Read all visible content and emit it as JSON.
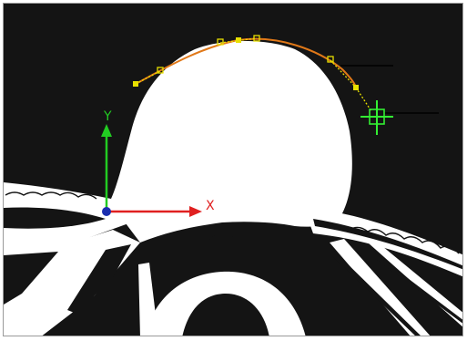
{
  "viewport": {
    "background_color": "#141414",
    "object_color": "#ffffff"
  },
  "axes": {
    "x_label": "X",
    "y_label": "Y",
    "x_color": "#e02020",
    "y_color": "#22cc22",
    "origin_color": "#1b2fb0"
  },
  "curve": {
    "spline_color": "#e07818",
    "handle_color": "#e8e000"
  },
  "cursor": {
    "icon": "crosshair-target-icon",
    "color": "#33ee33"
  }
}
